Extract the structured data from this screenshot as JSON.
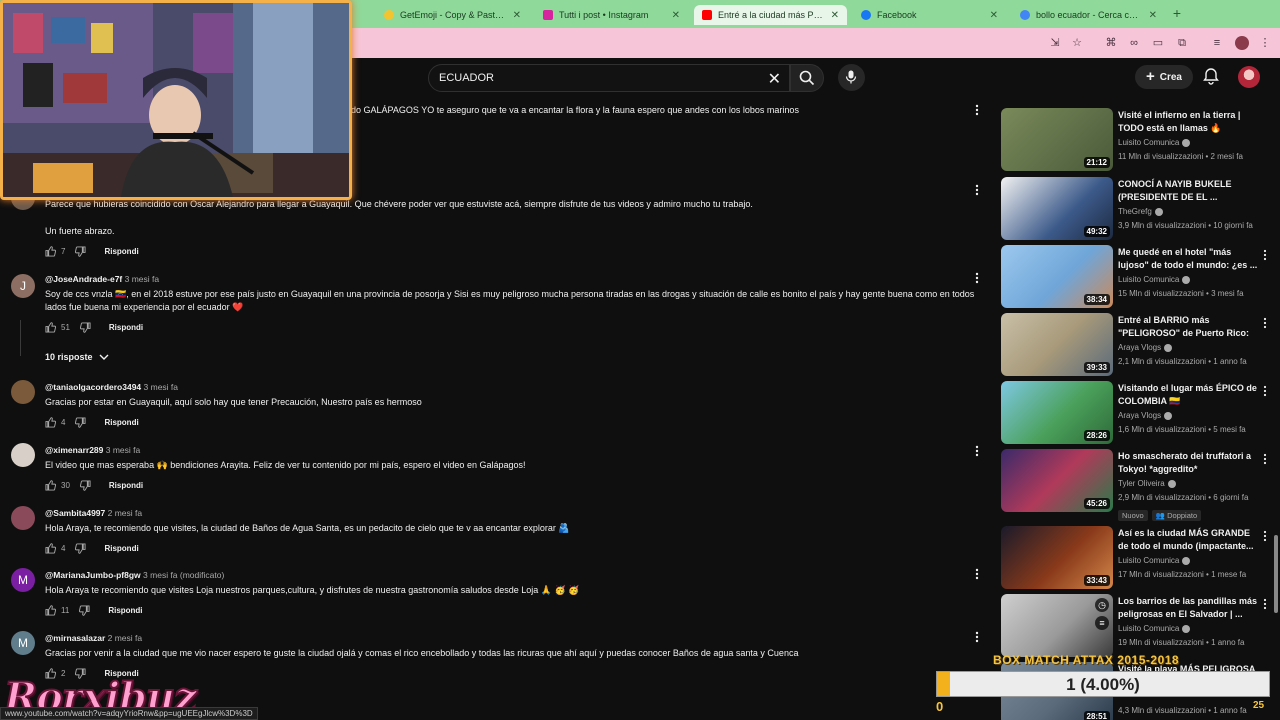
{
  "browser": {
    "tabs": [
      {
        "title": "GetEmoji - Copy & Paste All",
        "favicon_color": "#f4c430"
      },
      {
        "title": "Tutti i post • Instagram",
        "favicon_color": "#d6249f"
      },
      {
        "title": "Entré a la ciudad más PELIGR",
        "favicon_color": "#ff0000"
      },
      {
        "title": "Facebook",
        "favicon_color": "#1877f2"
      },
      {
        "title": "bollo ecuador - Cerca con Go",
        "favicon_color": "#4285f4"
      }
    ],
    "status_url": "www.youtube.com/watch?v=adqyYrioRnw&pp=ugUEEgJlcw%3D%3D"
  },
  "youtube_header": {
    "search_value": "ECUADOR",
    "create_label": "Crea"
  },
  "comments": [
    {
      "username": "",
      "time": "",
      "text": "do GALÁPAGOS YO te aseguro que te va a encantar la flora y la fauna espero que andes con los lobos marinos",
      "likes": "",
      "reply_label": "",
      "avatar_letter": "",
      "avatar_color": "#0f0f0f"
    },
    {
      "username": "",
      "time": "",
      "text": "Parece que hubieras coincidido con Oscar Alejandro para llegar a Guayaquil. Que chévere poder ver que estuviste acá, siempre disfrute de tus videos y admiro mucho tu trabajo.",
      "text2": "Un fuerte abrazo.",
      "likes": "7",
      "reply_label": "Rispondi",
      "avatar_letter": "",
      "avatar_color": "#6b5a4e"
    },
    {
      "username": "@JoseAndrade-e7f",
      "time": "3 mesi fa",
      "text": "Soy de ccs vnzla 🇻🇪, en el 2018 estuve por ese país justo en Guayaquil en una provincia de posorja y Sisi es muy peligroso mucha persona tiradas en las drogas y situación de calle es bonito el país y hay gente buena como en todos lados fue buena mi experiencia por el ecuador ❤️",
      "likes": "51",
      "reply_label": "Rispondi",
      "avatar_letter": "J",
      "avatar_color": "#8d6e63"
    },
    {
      "username": "@taniaolgacordero3494",
      "time": "3 mesi fa",
      "text": "Gracias por estar en Guayaquil,   aquí solo hay que tener Precaución,  Nuestro país es hermoso",
      "likes": "4",
      "reply_label": "Rispondi",
      "avatar_letter": "",
      "avatar_color": "#7a5a3a"
    },
    {
      "username": "@ximenarr289",
      "time": "3 mesi fa",
      "text": "El video que mas esperaba 🙌 bendiciones Arayita. Feliz de ver tu contenido por mi país, espero el video en Galápagos!",
      "likes": "30",
      "reply_label": "Rispondi",
      "avatar_letter": "",
      "avatar_color": "#d8d0c8"
    },
    {
      "username": "@Sambita4997",
      "time": "2 mesi fa",
      "text": "Hola Araya, te recomiendo que visites, la ciudad de Baños de Agua Santa, es un pedacito de cielo que te v aa encantar explorar 🫂",
      "likes": "4",
      "reply_label": "Rispondi",
      "avatar_letter": "",
      "avatar_color": "#8a4a5a"
    },
    {
      "username": "@MarianaJumbo-pf8gw",
      "time": "3 mesi fa (modificato)",
      "text": "Hola Araya te recomiendo que visites Loja nuestros parques,cultura, y disfrutes de nuestra gastronomía saludos desde Loja 🙏 🥳 🥳",
      "likes": "11",
      "reply_label": "Rispondi",
      "avatar_letter": "M",
      "avatar_color": "#7b1fa2"
    },
    {
      "username": "@mirnasalazar",
      "time": "2 mesi fa",
      "text": "Gracias por venir a la ciudad que me vio nacer espero te guste la ciudad ojalá y comas el rico encebollado y todas las ricuras que ahí aquí y puedas conocer Baños de agua santa y Cuenca",
      "likes": "2",
      "reply_label": "Rispondi",
      "avatar_letter": "M",
      "avatar_color": "#607d8b"
    }
  ],
  "replies_toggle": "10 risposte",
  "recommendations": [
    {
      "title": "Visité el infierno en la tierra | TODO está en llamas 🔥",
      "channel": "Luisito Comunica",
      "meta": "11 Mln di visualizzazioni • 2 mesi fa",
      "duration": "21:12",
      "thumb_color": "#7a8a5a"
    },
    {
      "title": "CONOCÍ A NAYIB BUKELE (PRESIDENTE DE EL ...",
      "channel": "TheGrefg",
      "meta": "3,9 Mln di visualizzazioni • 10 giorni fa",
      "duration": "49:32",
      "thumb_color": "#3c5a8a"
    },
    {
      "title": "Me quedé en el hotel \"más lujoso\" de todo el mundo: ¿es ...",
      "channel": "Luisito Comunica",
      "meta": "15 Mln di visualizzazioni • 3 mesi fa",
      "duration": "38:34",
      "thumb_color": "#6fa6d8"
    },
    {
      "title": "Entré al BARRIO más \"PELIGROSO\" de Puerto Rico: ...",
      "channel": "Araya Vlogs",
      "meta": "2,1 Mln di visualizzazioni • 1 anno fa",
      "duration": "39:33",
      "thumb_color": "#a89a7a"
    },
    {
      "title": "Visitando el lugar más ÉPICO de COLOMBIA 🇨🇴",
      "channel": "Araya Vlogs",
      "meta": "1,6 Mln di visualizzazioni • 5 mesi fa",
      "duration": "28:26",
      "thumb_color": "#4aa05a"
    },
    {
      "title": "Ho smascherato dei truffatori a Tokyo! *aggredito*",
      "channel": "Tyler Oliveira",
      "meta": "2,9 Mln di visualizzazioni • 6 giorni fa",
      "duration": "45:26",
      "thumb_color": "#b03a5a",
      "badges": [
        "Nuovo",
        "Doppiato"
      ]
    },
    {
      "title": "Así es la ciudad MÁS GRANDE de todo el mundo (impactante...",
      "channel": "Luisito Comunica",
      "meta": "17 Mln di visualizzazioni • 1 mese fa",
      "duration": "33:43",
      "thumb_color": "#8a3a1a"
    },
    {
      "title": "Los barrios de las pandillas más peligrosas en El Salvador | ...",
      "channel": "Luisito Comunica",
      "meta": "19 Mln di visualizzazioni • 1 anno fa",
      "duration": "",
      "thumb_color": "#9a9a9a"
    },
    {
      "title": "Visité la playa MÁS PELIGROSA",
      "channel": "",
      "meta": "4,3 Mln di visualizzazioni • 1 anno fa",
      "duration": "28:51",
      "thumb_color": "#5a6a7a"
    }
  ],
  "overlay": {
    "logo": "Rorxibuz",
    "attax_title": "BOX MATCH ATTAX 2015-2018",
    "attax_progress_label": "1 (4.00%)",
    "attax_progress_fraction": 0.04,
    "attax_min": "0",
    "attax_max": "25"
  }
}
